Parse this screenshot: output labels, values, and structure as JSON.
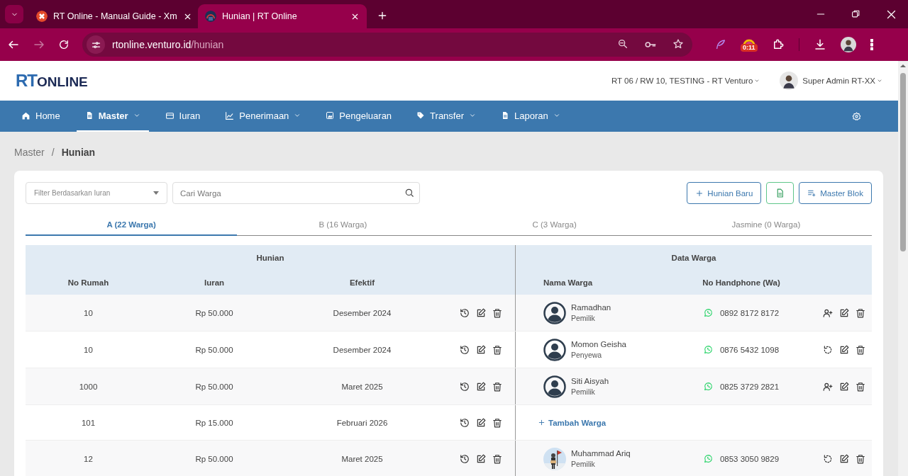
{
  "browser": {
    "tabs": [
      {
        "title": "RT Online - Manual Guide - Xm",
        "selected": false
      },
      {
        "title": "Hunian | RT Online",
        "selected": true
      }
    ],
    "url_host": "rtonline.venturo.id",
    "url_path": "/hunian",
    "extension_badge": "0:11"
  },
  "header": {
    "logo_part_1": "RT",
    "logo_part_2": "ONLINE",
    "location": "RT 06 / RW 10, TESTING - RT Venturo",
    "user": "Super Admin RT-XX"
  },
  "nav": [
    {
      "label": "Home",
      "dropdown": false,
      "selected": false
    },
    {
      "label": "Master",
      "dropdown": true,
      "selected": true
    },
    {
      "label": "Iuran",
      "dropdown": false,
      "selected": false
    },
    {
      "label": "Penerimaan",
      "dropdown": true,
      "selected": false
    },
    {
      "label": "Pengeluaran",
      "dropdown": false,
      "selected": false
    },
    {
      "label": "Transfer",
      "dropdown": true,
      "selected": false
    },
    {
      "label": "Laporan",
      "dropdown": true,
      "selected": false
    }
  ],
  "breadcrumb": {
    "items": [
      "Master",
      "Hunian"
    ],
    "separator": "/"
  },
  "toolbar": {
    "filter_placeholder": "Filter Berdasarkan Iuran",
    "search_placeholder": "Cari Warga",
    "buttons": [
      {
        "kind": "add",
        "label": "Hunian Baru"
      },
      {
        "kind": "export"
      },
      {
        "kind": "list",
        "label": "Master Blok"
      }
    ]
  },
  "block_tabs": [
    {
      "label": "A (22 Warga)",
      "selected": true
    },
    {
      "label": "B (16 Warga)",
      "selected": false
    },
    {
      "label": "C (3 Warga)",
      "selected": false
    },
    {
      "label": "Jasmine (0 Warga)",
      "selected": false
    }
  ],
  "table": {
    "groups": [
      "Hunian",
      "Data Warga"
    ],
    "columns": [
      "No Rumah",
      "Iuran",
      "Efektif",
      "Nama Warga",
      "No Handphone (Wa)"
    ],
    "rows": [
      {
        "no_rumah": "10",
        "iuran": "Rp 50.000",
        "efektif": "Desember 2024",
        "warga": {
          "kind": "resident",
          "avatar": {
            "kind": "default"
          },
          "name": "Ramadhan",
          "role": "Pemilik",
          "phone": "0892 8172 8172",
          "action": {
            "kind": "add"
          }
        }
      },
      {
        "no_rumah": "10",
        "iuran": "Rp 50.000",
        "efektif": "Desember 2024",
        "warga": {
          "kind": "resident",
          "avatar": {
            "kind": "default"
          },
          "name": "Momon Geisha",
          "role": "Penyewa",
          "phone": "0876 5432 1098",
          "action": {
            "kind": "reset"
          }
        }
      },
      {
        "no_rumah": "1000",
        "iuran": "Rp 50.000",
        "efektif": "Maret 2025",
        "warga": {
          "kind": "resident",
          "avatar": {
            "kind": "default"
          },
          "name": "Siti Aisyah",
          "role": "Pemilik",
          "phone": "0825 3729 2821",
          "action": {
            "kind": "add"
          }
        }
      },
      {
        "no_rumah": "101",
        "iuran": "Rp 15.000",
        "efektif": "Februari 2026",
        "warga": {
          "kind": "empty",
          "label": "Tambah Warga"
        }
      },
      {
        "no_rumah": "12",
        "iuran": "Rp 50.000",
        "efektif": "Maret 2025",
        "warga": {
          "kind": "resident",
          "name": "Muhammad Ariq",
          "role": "Pemilik",
          "phone": "0853 3050 9829",
          "action": {
            "kind": "reset"
          }
        }
      }
    ]
  }
}
